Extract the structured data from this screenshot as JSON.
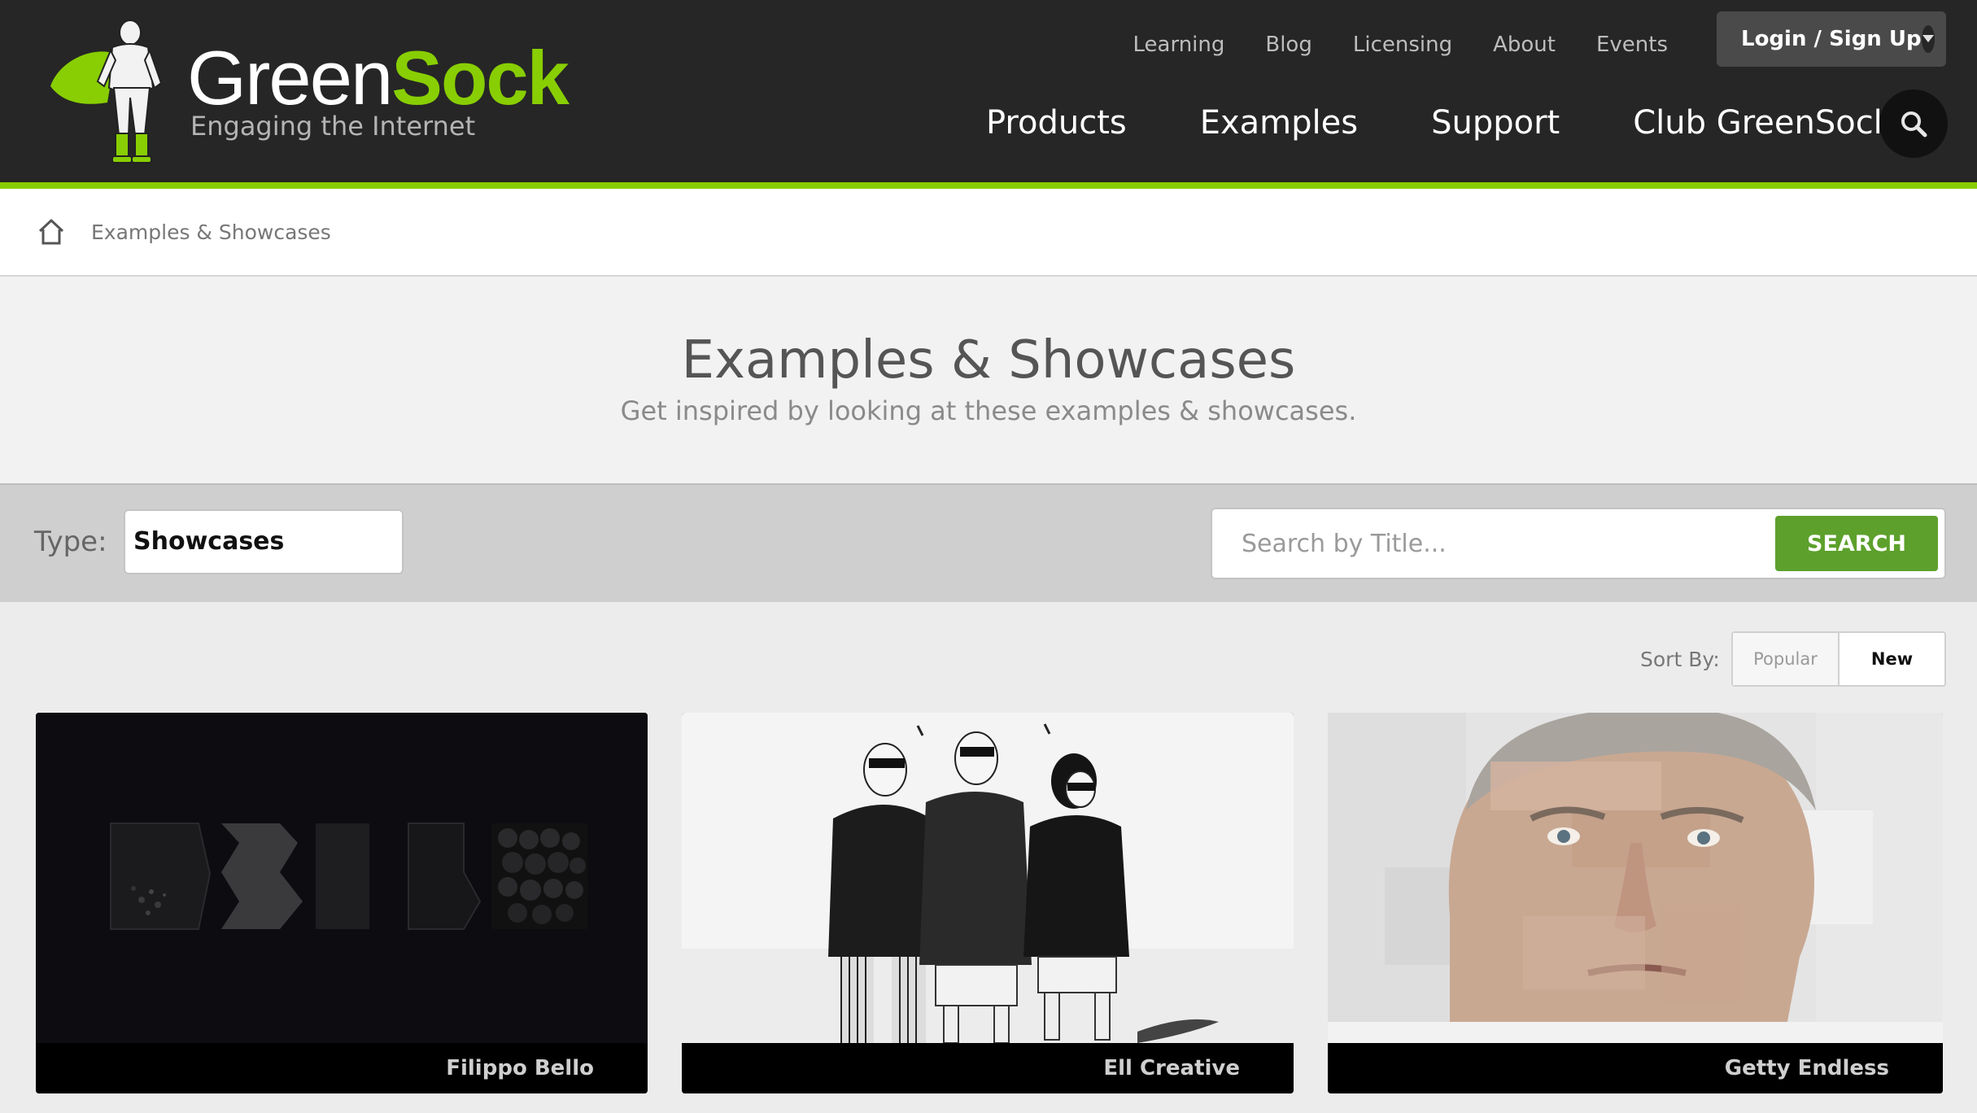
{
  "brand": {
    "name_main": "Green",
    "name_accent": "Sock",
    "tagline": "Engaging the Internet",
    "accent_color": "#88ce02"
  },
  "topnav": [
    "Learning",
    "Blog",
    "Licensing",
    "About",
    "Events"
  ],
  "login_label": "Login / Sign Up",
  "mainnav": [
    "Products",
    "Examples",
    "Support",
    "Club GreenSock"
  ],
  "breadcrumb": {
    "icon": "home-icon",
    "current": "Examples & Showcases"
  },
  "hero": {
    "title": "Examples & Showcases",
    "subtitle": "Get inspired by looking at these examples & showcases."
  },
  "filter": {
    "type_label": "Type:",
    "type_value": "Showcases",
    "search_placeholder": "Search by Title...",
    "search_button": "SEARCH",
    "search_button_color": "#5da02c"
  },
  "sort": {
    "label": "Sort By:",
    "options": [
      "Popular",
      "New"
    ],
    "selected": "New"
  },
  "cards": [
    {
      "caption": "Filippo Bello"
    },
    {
      "caption": "Ell Creative"
    },
    {
      "caption": "Getty Endless"
    }
  ]
}
